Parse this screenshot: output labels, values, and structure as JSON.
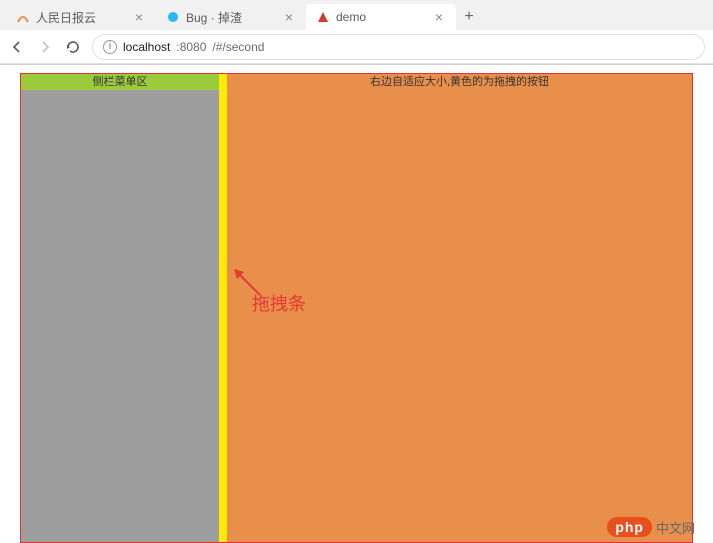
{
  "browser": {
    "tabs": [
      {
        "title": "人民日报云",
        "favicon_color": "#e88f4c",
        "active": false
      },
      {
        "title": "Bug · 掉渣",
        "favicon_color": "#29b6f6",
        "active": false
      },
      {
        "title": "demo",
        "favicon_color": "#d23b2f",
        "active": true
      }
    ],
    "url_host": "localhost",
    "url_port": ":8080",
    "url_path": "/#/second"
  },
  "layout": {
    "sidebar_title": "侧栏菜单区",
    "main_title": "右边自适应大小,黄色的为拖拽的按钮",
    "colors": {
      "sidebar_bg": "#9e9e9e",
      "sidebar_header": "#9bcb3c",
      "drag_bar": "#ffea00",
      "main_bg": "#e88f4c",
      "frame_border": "#d33"
    }
  },
  "annotation": {
    "label": "拖拽条"
  },
  "watermark": {
    "brand": "php",
    "text": "中文网"
  }
}
